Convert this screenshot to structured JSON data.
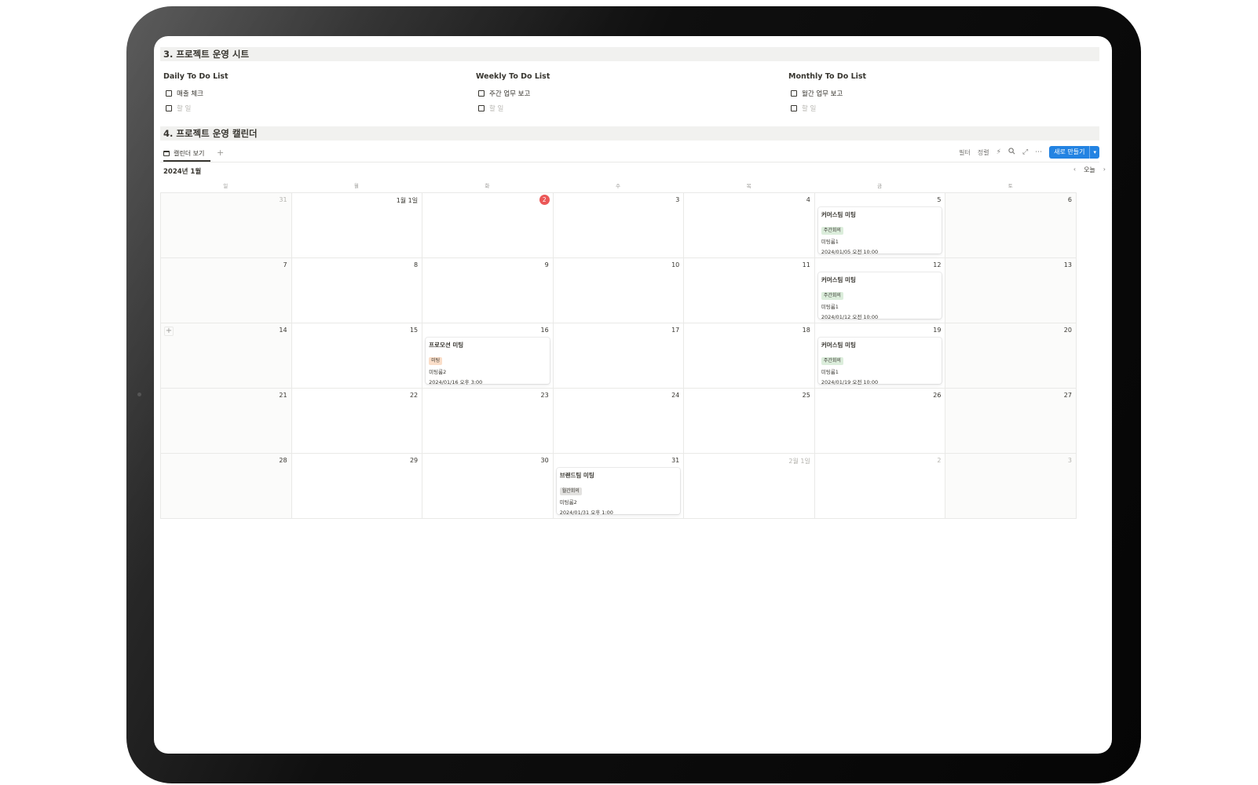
{
  "sections": {
    "sheet_title": "3. 프로젝트 운영 시트",
    "calendar_title": "4. 프로젝트 운영 캘린더"
  },
  "todos": [
    {
      "title": "Daily To Do List",
      "items": [
        {
          "text": "매출 체크",
          "placeholder": false
        },
        {
          "text": "할 일",
          "placeholder": true
        }
      ]
    },
    {
      "title": "Weekly To Do List",
      "items": [
        {
          "text": "주간 업무 보고",
          "placeholder": false
        },
        {
          "text": "할 일",
          "placeholder": true
        }
      ]
    },
    {
      "title": "Monthly To Do List",
      "items": [
        {
          "text": "월간 업무 보고",
          "placeholder": false
        },
        {
          "text": "할 일",
          "placeholder": true
        }
      ]
    }
  ],
  "tabs": {
    "view_label": "캘린더 보기",
    "add": "+"
  },
  "toolbar": {
    "filter": "필터",
    "sort": "정렬",
    "new_button": "새로 만들기"
  },
  "calendar": {
    "month_label": "2024년 1월",
    "today_label": "오늘",
    "weekdays": [
      "일",
      "월",
      "화",
      "수",
      "목",
      "금",
      "토"
    ],
    "weeks": [
      [
        "31",
        "1월 1일",
        "2",
        "3",
        "4",
        "5",
        "6"
      ],
      [
        "7",
        "8",
        "9",
        "10",
        "11",
        "12",
        "13"
      ],
      [
        "14",
        "15",
        "16",
        "17",
        "18",
        "19",
        "20"
      ],
      [
        "21",
        "22",
        "23",
        "24",
        "25",
        "26",
        "27"
      ],
      [
        "28",
        "29",
        "30",
        "31",
        "2월 1일",
        "2",
        "3"
      ]
    ],
    "other_month": [
      [
        0,
        0
      ],
      [
        4,
        4
      ],
      [
        4,
        5
      ],
      [
        4,
        6
      ]
    ],
    "today": [
      0,
      2
    ],
    "events": [
      {
        "week": 0,
        "day": 5,
        "title": "커머스팀 미팅",
        "tag": "주간회의",
        "tag_color": "#dbeddb",
        "room": "미팅룸1",
        "time": "2024/01/05 오전 10:00"
      },
      {
        "week": 1,
        "day": 5,
        "title": "커머스팀 미팅",
        "tag": "주간회의",
        "tag_color": "#dbeddb",
        "room": "미팅룸1",
        "time": "2024/01/12 오전 10:00"
      },
      {
        "week": 2,
        "day": 2,
        "title": "프로모션 미팅",
        "tag": "미팅",
        "tag_color": "#fadec9",
        "room": "미팅룸2",
        "time": "2024/01/16 오후 3:00"
      },
      {
        "week": 2,
        "day": 5,
        "title": "커머스팀 미팅",
        "tag": "주간회의",
        "tag_color": "#dbeddb",
        "room": "미팅룸1",
        "time": "2024/01/19 오전 10:00"
      },
      {
        "week": 4,
        "day": 3,
        "title": "브랜드팀 미팅",
        "tag": "월간회의",
        "tag_color": "#e3e2e0",
        "room": "미팅룸2",
        "time": "2024/01/31 오후 1:00"
      }
    ]
  },
  "colors": {
    "accent": "#2383e2",
    "today": "#eb5757",
    "header_bg": "#f1f1ef"
  },
  "icons": [
    "calendar-icon",
    "plus-icon",
    "lightning-icon",
    "search-icon",
    "expand-icon",
    "more-icon",
    "chevron-left-icon",
    "chevron-right-icon",
    "chevron-down-icon"
  ]
}
